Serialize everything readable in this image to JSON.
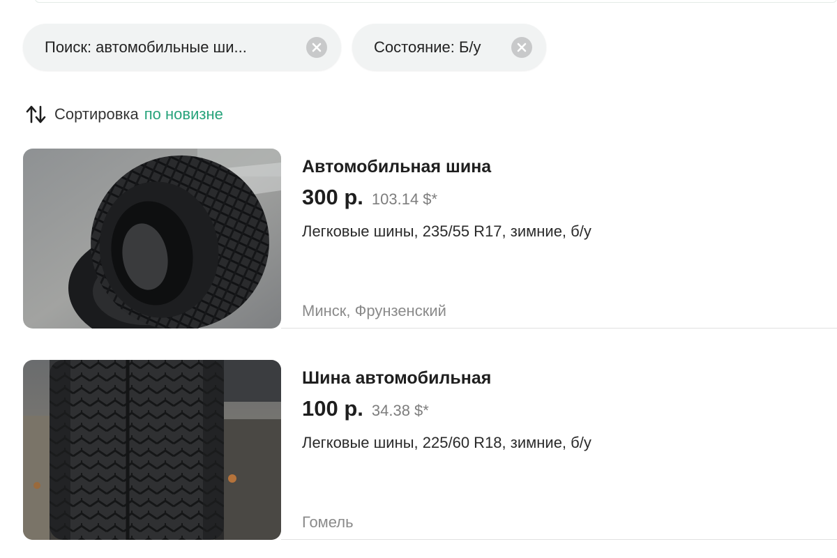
{
  "filters": [
    {
      "label": "Поиск: автомобильные ши..."
    },
    {
      "label": "Состояние: Б/у"
    }
  ],
  "sort": {
    "label": "Сортировка",
    "value": "по новизне"
  },
  "listings": [
    {
      "title": "Автомобильная шина",
      "price": "300 р.",
      "price_usd": "103.14 $*",
      "description": "Легковые шины, 235/55 R17, зимние, б/у",
      "location": "Минск, Фрунзенский"
    },
    {
      "title": "Шина автомобильная",
      "price": "100 р.",
      "price_usd": "34.38 $*",
      "description": "Легковые шины, 225/60 R18, зимние, б/у",
      "location": "Гомель"
    }
  ],
  "colors": {
    "accent": "#27a37b",
    "chip_bg": "#f1f3f3",
    "muted": "#8a8a8a"
  }
}
